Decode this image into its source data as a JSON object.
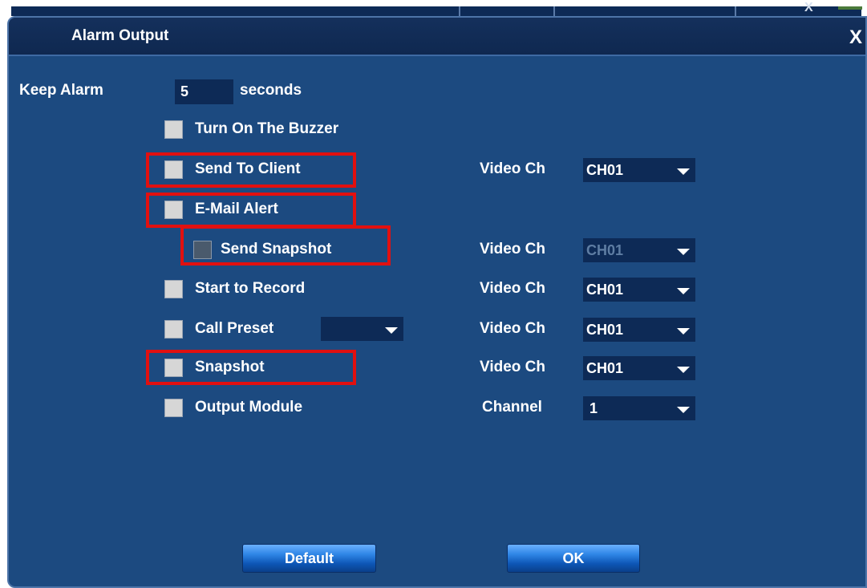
{
  "dialog": {
    "title": "Alarm Output",
    "close_glyph": "X",
    "keep_alarm_label": "Keep Alarm",
    "keep_alarm_value": "5",
    "seconds_label": "seconds"
  },
  "background": {
    "corner_mark": "X"
  },
  "options": {
    "buzzer": {
      "label": "Turn On The Buzzer",
      "checked": false
    },
    "send_to_client": {
      "label": "Send To Client",
      "checked": false,
      "ch_label": "Video Ch",
      "ch_value": "CH01"
    },
    "email_alert": {
      "label": "E-Mail Alert",
      "checked": false
    },
    "send_snapshot": {
      "label": "Send Snapshot",
      "checked": false,
      "disabled": true,
      "ch_label": "Video Ch",
      "ch_value": "CH01"
    },
    "start_record": {
      "label": "Start to Record",
      "checked": false,
      "ch_label": "Video Ch",
      "ch_value": "CH01"
    },
    "call_preset": {
      "label": "Call Preset",
      "checked": false,
      "preset_value": "",
      "ch_label": "Video Ch",
      "ch_value": "CH01"
    },
    "snapshot": {
      "label": "Snapshot",
      "checked": false,
      "ch_label": "Video Ch",
      "ch_value": "CH01"
    },
    "output_module": {
      "label": "Output Module",
      "checked": false,
      "ch_label": "Channel",
      "ch_value": "1"
    }
  },
  "buttons": {
    "default_label": "Default",
    "ok_label": "OK"
  },
  "colors": {
    "dialog_bg": "#1c4a80",
    "field_bg": "#0d2a56",
    "highlight": "#e11010",
    "button": "#2f86e6"
  },
  "icons": {
    "dropdown": "chevron-down-icon",
    "close": "close-icon"
  }
}
